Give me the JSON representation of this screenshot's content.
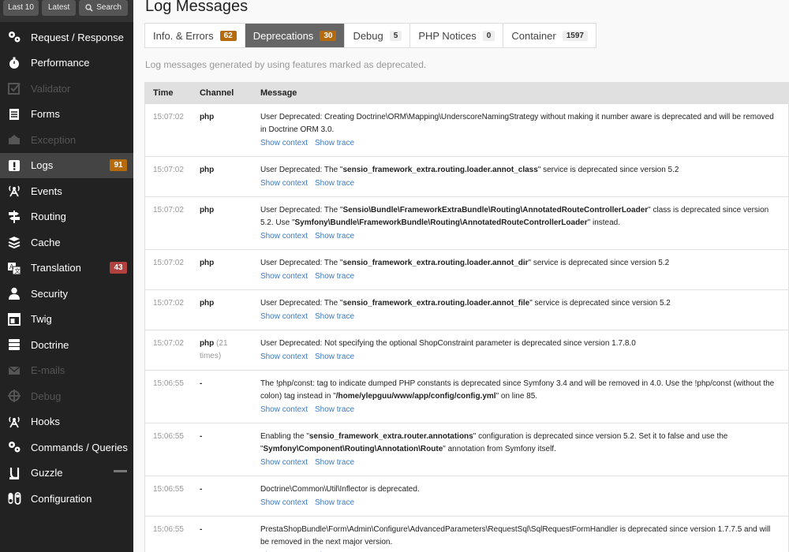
{
  "topbar": {
    "last10": "Last 10",
    "latest": "Latest",
    "search": "Search"
  },
  "menu": [
    {
      "label": "Request / Response",
      "icon": "gears-icon",
      "state": "normal"
    },
    {
      "label": "Performance",
      "icon": "stopwatch-icon",
      "state": "normal"
    },
    {
      "label": "Validator",
      "icon": "checkbox-icon",
      "state": "disabled"
    },
    {
      "label": "Forms",
      "icon": "form-icon",
      "state": "normal"
    },
    {
      "label": "Exception",
      "icon": "bomb-icon",
      "state": "disabled"
    },
    {
      "label": "Logs",
      "icon": "alert-icon",
      "state": "selected",
      "count": "91",
      "count_color": "orange"
    },
    {
      "label": "Events",
      "icon": "antenna-icon",
      "state": "normal"
    },
    {
      "label": "Routing",
      "icon": "signpost-icon",
      "state": "normal"
    },
    {
      "label": "Cache",
      "icon": "stack-icon",
      "state": "normal"
    },
    {
      "label": "Translation",
      "icon": "translate-icon",
      "state": "normal",
      "count": "43",
      "count_color": "red"
    },
    {
      "label": "Security",
      "icon": "user-icon",
      "state": "normal"
    },
    {
      "label": "Twig",
      "icon": "template-icon",
      "state": "normal"
    },
    {
      "label": "Doctrine",
      "icon": "database-icon",
      "state": "normal"
    },
    {
      "label": "E-mails",
      "icon": "envelope-icon",
      "state": "disabled"
    },
    {
      "label": "Debug",
      "icon": "crosshair-icon",
      "state": "disabled"
    },
    {
      "label": "Hooks",
      "icon": "antenna-icon",
      "state": "normal"
    },
    {
      "label": "Commands / Queries",
      "icon": "gears-icon",
      "state": "normal"
    },
    {
      "label": "Guzzle",
      "icon": "guzzle-icon",
      "state": "normal",
      "dash": true
    },
    {
      "label": "Configuration",
      "icon": "toggle-icon",
      "state": "normal"
    }
  ],
  "page_title": "Log Messages",
  "tabs": [
    {
      "label": "Info. & Errors",
      "count": "62",
      "badge": "orange",
      "active": false
    },
    {
      "label": "Deprecations",
      "count": "30",
      "badge": "orange",
      "active": true
    },
    {
      "label": "Debug",
      "count": "5",
      "badge": "plain",
      "active": false
    },
    {
      "label": "PHP Notices",
      "count": "0",
      "badge": "plain",
      "active": false
    },
    {
      "label": "Container",
      "count": "1597",
      "badge": "plain",
      "active": false
    }
  ],
  "description": "Log messages generated by using features marked as deprecated.",
  "table": {
    "headers": {
      "time": "Time",
      "channel": "Channel",
      "message": "Message"
    },
    "show_context": "Show context",
    "show_trace": "Show trace",
    "rows": [
      {
        "time": "15:07:02",
        "channel": "php",
        "times": "",
        "parts": [
          {
            "t": "User Deprecated: Creating Doctrine\\ORM\\Mapping\\UnderscoreNamingStrategy without making it number aware is deprecated and will be removed in Doctrine ORM 3.0.",
            "b": false
          }
        ]
      },
      {
        "time": "15:07:02",
        "channel": "php",
        "times": "",
        "parts": [
          {
            "t": "User Deprecated: The \"",
            "b": false
          },
          {
            "t": "sensio_framework_extra.routing.loader.annot_class",
            "b": true
          },
          {
            "t": "\" service is deprecated since version 5.2",
            "b": false
          }
        ]
      },
      {
        "time": "15:07:02",
        "channel": "php",
        "times": "",
        "parts": [
          {
            "t": "User Deprecated: The \"",
            "b": false
          },
          {
            "t": "Sensio\\Bundle\\FrameworkExtraBundle\\Routing\\AnnotatedRouteControllerLoader",
            "b": true
          },
          {
            "t": "\" class is deprecated since version 5.2. Use \"",
            "b": false
          },
          {
            "t": "Symfony\\Bundle\\FrameworkBundle\\Routing\\AnnotatedRouteControllerLoader",
            "b": true
          },
          {
            "t": "\" instead.",
            "b": false
          }
        ]
      },
      {
        "time": "15:07:02",
        "channel": "php",
        "times": "",
        "parts": [
          {
            "t": "User Deprecated: The \"",
            "b": false
          },
          {
            "t": "sensio_framework_extra.routing.loader.annot_dir",
            "b": true
          },
          {
            "t": "\" service is deprecated since version 5.2",
            "b": false
          }
        ]
      },
      {
        "time": "15:07:02",
        "channel": "php",
        "times": "",
        "parts": [
          {
            "t": "User Deprecated: The \"",
            "b": false
          },
          {
            "t": "sensio_framework_extra.routing.loader.annot_file",
            "b": true
          },
          {
            "t": "\" service is deprecated since version 5.2",
            "b": false
          }
        ]
      },
      {
        "time": "15:07:02",
        "channel": "php",
        "times": "(21 times)",
        "parts": [
          {
            "t": "User Deprecated: Not specifying the optional ShopConstraint parameter is deprecated since version 1.7.8.0",
            "b": false
          }
        ]
      },
      {
        "time": "15:06:55",
        "channel": "-",
        "times": "",
        "parts": [
          {
            "t": "The !php/const: tag to indicate dumped PHP constants is deprecated since Symfony 3.4 and will be removed in 4.0. Use the !php/const (without the colon) tag instead in \"",
            "b": false
          },
          {
            "t": "/home/ylepguu/www/app/config/config.yml",
            "b": true
          },
          {
            "t": "\" on line 85.",
            "b": false
          }
        ]
      },
      {
        "time": "15:06:55",
        "channel": "-",
        "times": "",
        "parts": [
          {
            "t": "Enabling the \"",
            "b": false
          },
          {
            "t": "sensio_framework_extra.router.annotations",
            "b": true
          },
          {
            "t": "\" configuration is deprecated since version 5.2. Set it to false and use the \"",
            "b": false
          },
          {
            "t": "Symfony\\Component\\Routing\\Annotation\\Route",
            "b": true
          },
          {
            "t": "\" annotation from Symfony itself.",
            "b": false
          }
        ]
      },
      {
        "time": "15:06:55",
        "channel": "-",
        "times": "",
        "parts": [
          {
            "t": "Doctrine\\Common\\Util\\Inflector is deprecated.",
            "b": false
          }
        ]
      },
      {
        "time": "15:06:55",
        "channel": "-",
        "times": "",
        "parts": [
          {
            "t": "PrestaShopBundle\\Form\\Admin\\Configure\\AdvancedParameters\\RequestSql\\SqlRequestFormHandler is deprecated since version 1.7.7.5 and will be removed in the next major version.",
            "b": false
          }
        ]
      }
    ]
  }
}
